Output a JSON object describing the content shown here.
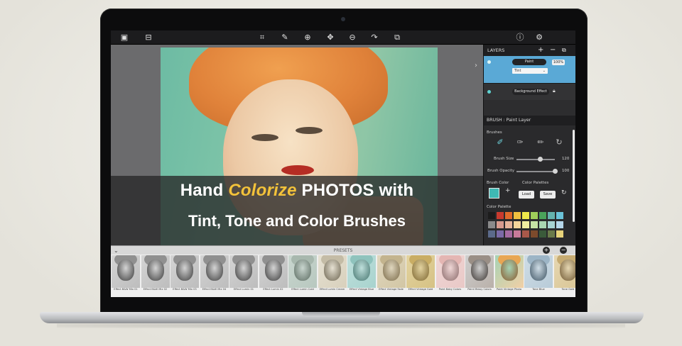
{
  "toolbar": {
    "left_icons": [
      "image-icon",
      "tray-icon"
    ],
    "center_icons": [
      "crop-icon",
      "brush-icon",
      "zoom-in-icon",
      "move-icon",
      "zoom-out-icon",
      "redo-icon",
      "export-icon"
    ],
    "right_icons": [
      "info-icon",
      "settings-icon"
    ]
  },
  "caption": {
    "line1_part1": "Hand",
    "line1_highlight": "Colorize",
    "line1_part2": "PHOTOS with",
    "line2": "Tint, Tone and Color Brushes"
  },
  "layers": {
    "title": "LAYERS",
    "add_label": "+",
    "remove_label": "−",
    "items": [
      {
        "name": "Paint",
        "opacity": "100%",
        "blend": "Tint"
      },
      {
        "name": "Background Effect"
      }
    ]
  },
  "brush": {
    "title": "BRUSH : Paint Layer",
    "brushes_label": "Brushes",
    "size_label": "Brush Size",
    "size_value": "120",
    "size_fraction": 0.62,
    "opacity_label": "Brush Opacity",
    "opacity_value": "100",
    "opacity_fraction": 1.0,
    "color_label": "Brush Color",
    "palettes_label": "Color Palettes",
    "load_label": "Load",
    "save_label": "Save",
    "palette_label": "Color Palette",
    "brush_color": "#3fb8b4",
    "palette": [
      "#1c1c1c",
      "#c93a2e",
      "#e06a2b",
      "#f1c03f",
      "#eee74a",
      "#9fcf5a",
      "#4aa35a",
      "#64b2ad",
      "#6bc3d9",
      "#8a8a8a",
      "#d79b8e",
      "#e6b49a",
      "#f4d59a",
      "#f0eea0",
      "#c6e3a5",
      "#a9d6b2",
      "#a6d3d3",
      "#b5d7ea",
      "#5b6a8a",
      "#7b6aa6",
      "#a56ba1",
      "#c87a9a",
      "#a8584a",
      "#7c4a2c",
      "#3a5a3a",
      "#6a7a4a",
      "#e6d27a"
    ]
  },
  "presets": {
    "title": "PRESETS",
    "items": [
      {
        "label": "Effect B&W Mix 01",
        "tone": "bw"
      },
      {
        "label": "Effect B&W Mix 02",
        "tone": "bw"
      },
      {
        "label": "Effect B&W Mix 03",
        "tone": "bw"
      },
      {
        "label": "Effect B&W Mix 04",
        "tone": "bw"
      },
      {
        "label": "Effect Lumin 01",
        "tone": "bw"
      },
      {
        "label": "Effect Lumin 02",
        "tone": "bw"
      },
      {
        "label": "Effect Lumin Cold",
        "tone": "cold"
      },
      {
        "label": "Effect Lumin Cream",
        "tone": "cream"
      },
      {
        "label": "Effect Vintage Blue",
        "tone": "blue"
      },
      {
        "label": "Effect Vintage Fade",
        "tone": "fade"
      },
      {
        "label": "Effect Vintage Gold",
        "tone": "gold"
      },
      {
        "label": "Paint Baby Colors",
        "tone": "baby"
      },
      {
        "label": "Paint Messy Colors",
        "tone": "messy"
      },
      {
        "label": "Paint Vintage Photo",
        "tone": "vintage"
      },
      {
        "label": "Tone Blue",
        "tone": "toneblue"
      },
      {
        "label": "Tone Gold",
        "tone": "tonegold"
      }
    ]
  }
}
